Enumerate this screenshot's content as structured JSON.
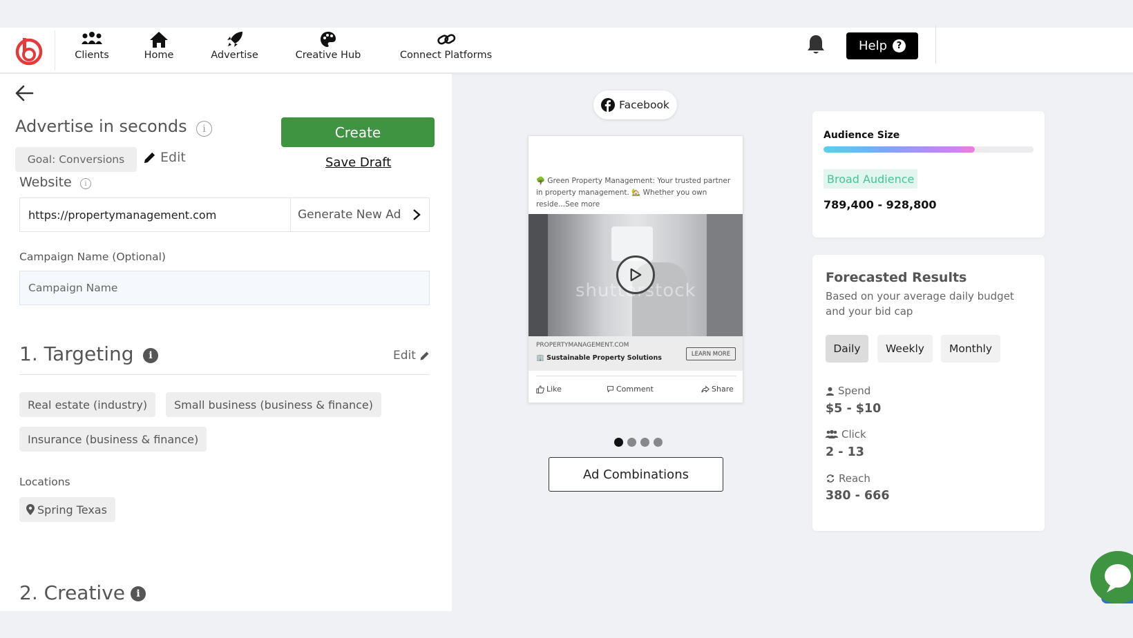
{
  "nav": {
    "items": [
      {
        "label": "Clients",
        "icon": "users-icon"
      },
      {
        "label": "Home",
        "icon": "home-icon"
      },
      {
        "label": "Advertise",
        "icon": "rocket-icon"
      },
      {
        "label": "Creative Hub",
        "icon": "palette-icon"
      },
      {
        "label": "Connect Platforms",
        "icon": "link-icon"
      }
    ],
    "help_label": "Help",
    "help_icon": "?"
  },
  "builder": {
    "title": "Advertise in seconds",
    "goal": "Goal: Conversions",
    "edit_label": "Edit",
    "create_label": "Create",
    "save_draft_label": "Save Draft",
    "website_label": "Website",
    "website_value": "https://propertymanagement.com",
    "generate_label": "Generate New Ad",
    "campaign_name_label": "Campaign Name (Optional)",
    "campaign_name_placeholder": "Campaign Name",
    "targeting_title": "1.  Targeting",
    "targeting_edit": "Edit",
    "interests": [
      "Real estate (industry)",
      "Small business (business & finance)",
      "Insurance (business & finance)"
    ],
    "locations_label": "Locations",
    "location": "Spring Texas",
    "creative_title": "2. Creative"
  },
  "preview": {
    "platform": "Facebook",
    "ad_text": "🌳 Green Property Management: Your trusted partner in property management. 🏡 Whether you own reside...See more",
    "watermark": "shutterstock",
    "domain": "PROPERTYMANAGEMENT.COM",
    "headline": "🏢 Sustainable Property Solutions",
    "cta": "LEARN MORE",
    "actions": {
      "like": "Like",
      "comment": "Comment",
      "share": "Share"
    },
    "carousel_count": 4,
    "carousel_active": 0,
    "combinations_label": "Ad Combinations"
  },
  "audience": {
    "title": "Audience Size",
    "fill_fraction": 0.72,
    "badge": "Broad Audience",
    "range": "789,400 - 928,800"
  },
  "forecast": {
    "title": "Forecasted Results",
    "subtitle": "Based on your average daily budget and your bid cap",
    "periods": [
      "Daily",
      "Weekly",
      "Monthly"
    ],
    "active_period": "Daily",
    "spend_label": "Spend",
    "spend_value": "$5 - $10",
    "click_label": "Click",
    "click_value": "2 - 13",
    "reach_label": "Reach",
    "reach_value": "380 - 666"
  },
  "colors": {
    "create_green": "#3f9441",
    "broad_audience_text": "#43c49a",
    "broad_audience_bg": "#e3f5ef"
  }
}
